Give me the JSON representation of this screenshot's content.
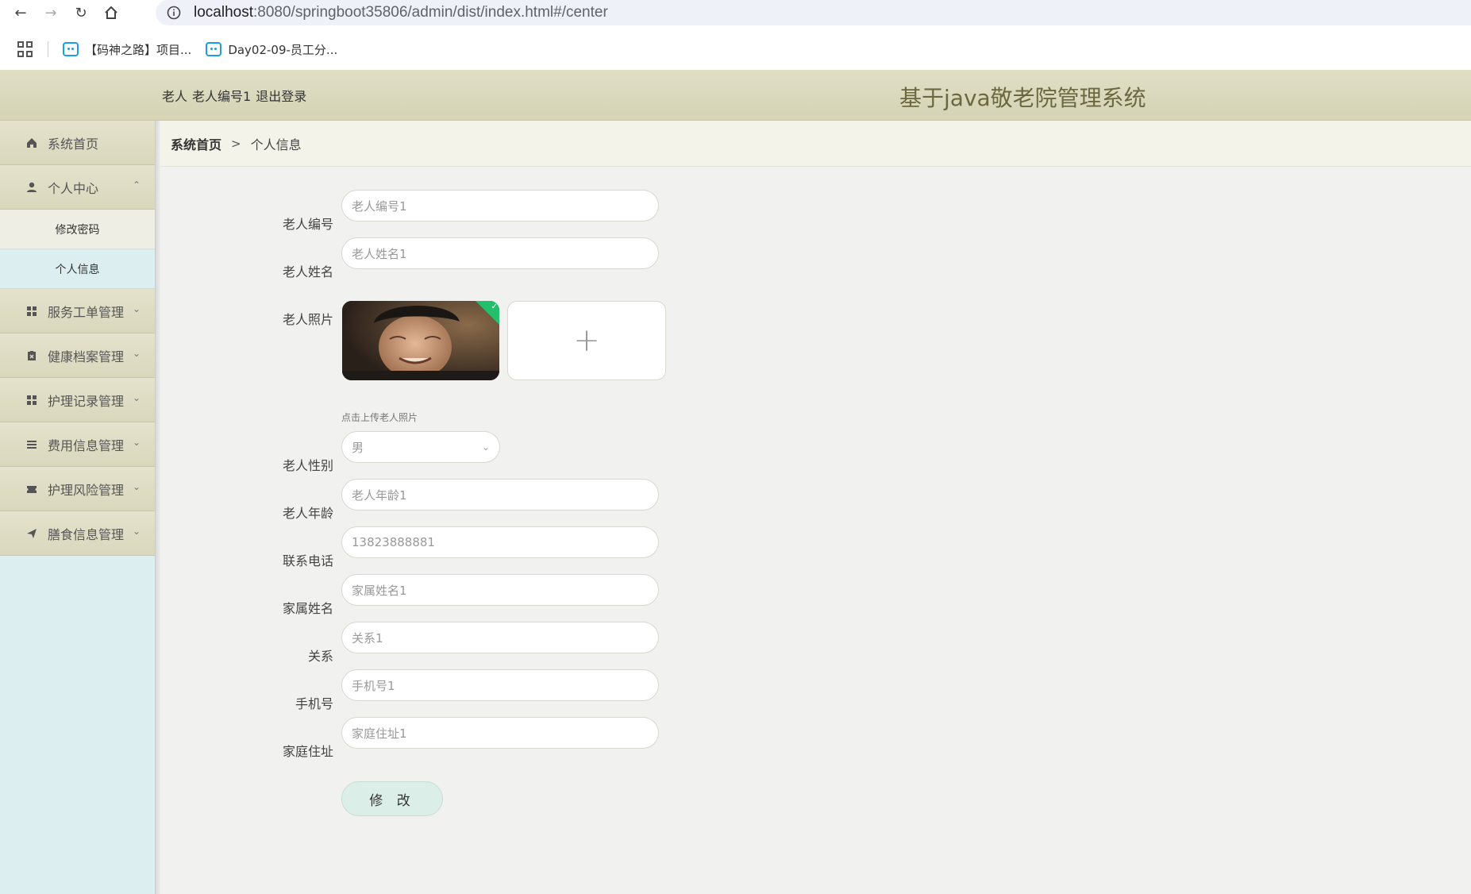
{
  "browser": {
    "url_host": "localhost",
    "url_rest": ":8080/springboot35806/admin/dist/index.html#/center",
    "bookmarks": [
      {
        "label": "【码神之路】项目..."
      },
      {
        "label": "Day02-09-员工分..."
      }
    ]
  },
  "header": {
    "role": "老人",
    "username": "老人编号1",
    "logout": "退出登录",
    "title": "基于java敬老院管理系统"
  },
  "sidebar": {
    "items": [
      {
        "label": "系统首页",
        "icon": "home-icon"
      },
      {
        "label": "个人中心",
        "icon": "user-icon"
      },
      {
        "label": "服务工单管理",
        "icon": "grid-icon"
      },
      {
        "label": "健康档案管理",
        "icon": "clipboard-icon"
      },
      {
        "label": "护理记录管理",
        "icon": "grid-icon"
      },
      {
        "label": "费用信息管理",
        "icon": "list-icon"
      },
      {
        "label": "护理风险管理",
        "icon": "ticket-icon"
      },
      {
        "label": "膳食信息管理",
        "icon": "send-icon"
      }
    ],
    "sub_items": [
      {
        "label": "修改密码"
      },
      {
        "label": "个人信息"
      }
    ]
  },
  "breadcrumb": {
    "home": "系统首页",
    "sep": ">",
    "current": "个人信息"
  },
  "form": {
    "elder_no": {
      "label": "老人编号",
      "value": "老人编号1"
    },
    "elder_name": {
      "label": "老人姓名",
      "value": "老人姓名1"
    },
    "photo": {
      "label": "老人照片",
      "tip": "点击上传老人照片"
    },
    "gender": {
      "label": "老人性别",
      "value": "男"
    },
    "age": {
      "label": "老人年龄",
      "value": "老人年龄1"
    },
    "phone": {
      "label": "联系电话",
      "value": "13823888881"
    },
    "family_name": {
      "label": "家属姓名",
      "value": "家属姓名1"
    },
    "relation": {
      "label": "关系",
      "value": "关系1"
    },
    "mobile": {
      "label": "手机号",
      "value": "手机号1"
    },
    "address": {
      "label": "家庭住址",
      "value": "家庭住址1"
    },
    "submit": "修 改"
  }
}
